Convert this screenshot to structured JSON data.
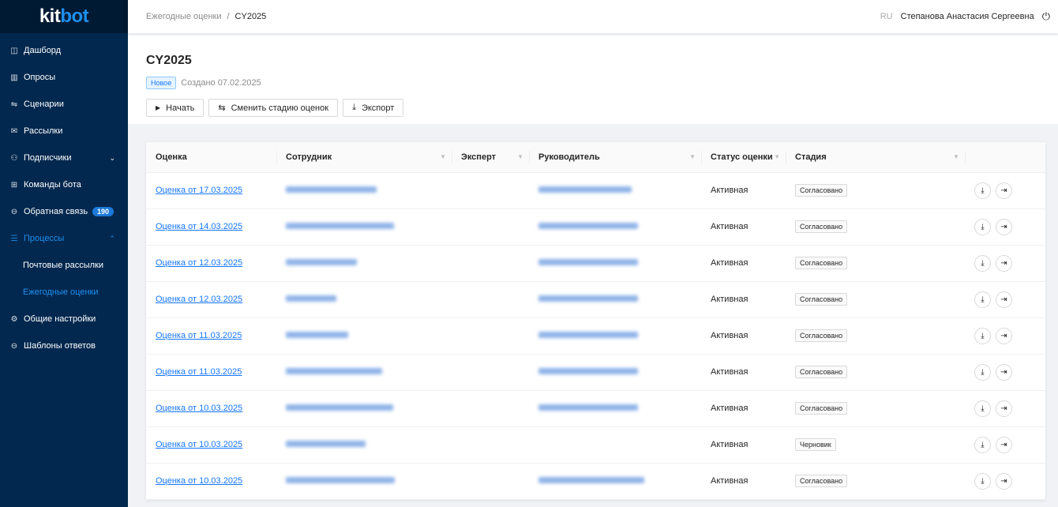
{
  "sidebar": {
    "logo": "kitbot",
    "items": [
      {
        "label": "Дашборд",
        "icon": "chart-line-icon"
      },
      {
        "label": "Опросы",
        "icon": "bar-chart-icon"
      },
      {
        "label": "Сценарии",
        "icon": "flow-icon"
      },
      {
        "label": "Рассылки",
        "icon": "mail-icon"
      },
      {
        "label": "Подписчики",
        "icon": "users-icon",
        "chevron": "down"
      },
      {
        "label": "Команды бота",
        "icon": "grid-icon"
      },
      {
        "label": "Обратная связь",
        "icon": "feedback-icon",
        "badge": "190"
      },
      {
        "label": "Процессы",
        "icon": "list-icon",
        "chevron": "up",
        "active": true
      },
      {
        "label": "Почтовые рассылки",
        "sub": true
      },
      {
        "label": "Ежегодные оценки",
        "sub": true,
        "active": true
      },
      {
        "label": "Общие настройки",
        "icon": "gear-icon"
      },
      {
        "label": "Шаблоны ответов",
        "icon": "template-icon"
      }
    ]
  },
  "header": {
    "breadcrumb": [
      "Ежегодные оценки",
      "CY2025"
    ],
    "lang": "RU",
    "user": "Степанова Анастасия Сергеевна"
  },
  "page": {
    "title": "CY2025",
    "status": "Новое",
    "created": "Создано 07.02.2025",
    "buttons": {
      "start": "Начать",
      "change_stage": "Сменить стадию оценок",
      "export": "Экспорт"
    }
  },
  "table": {
    "columns": [
      "Оценка",
      "Сотрудник",
      "Эксперт",
      "Руководитель",
      "Статус оценки",
      "Стадия"
    ],
    "rows": [
      {
        "assessment": "Оценка от 17.03.2025",
        "status": "Активная",
        "stage": "Согласовано",
        "manager": true
      },
      {
        "assessment": "Оценка от 14.03.2025",
        "status": "Активная",
        "stage": "Согласовано",
        "manager": true
      },
      {
        "assessment": "Оценка от 12.03.2025",
        "status": "Активная",
        "stage": "Согласовано",
        "manager": true
      },
      {
        "assessment": "Оценка от 12.03.2025",
        "status": "Активная",
        "stage": "Согласовано",
        "manager": true
      },
      {
        "assessment": "Оценка от 11.03.2025",
        "status": "Активная",
        "stage": "Согласовано",
        "manager": true
      },
      {
        "assessment": "Оценка от 11.03.2025",
        "status": "Активная",
        "stage": "Согласовано",
        "manager": true
      },
      {
        "assessment": "Оценка от 10.03.2025",
        "status": "Активная",
        "stage": "Согласовано",
        "manager": true
      },
      {
        "assessment": "Оценка от 10.03.2025",
        "status": "Активная",
        "stage": "Черновик",
        "manager": false
      },
      {
        "assessment": "Оценка от 10.03.2025",
        "status": "Активная",
        "stage": "Согласовано",
        "manager": true
      }
    ]
  }
}
